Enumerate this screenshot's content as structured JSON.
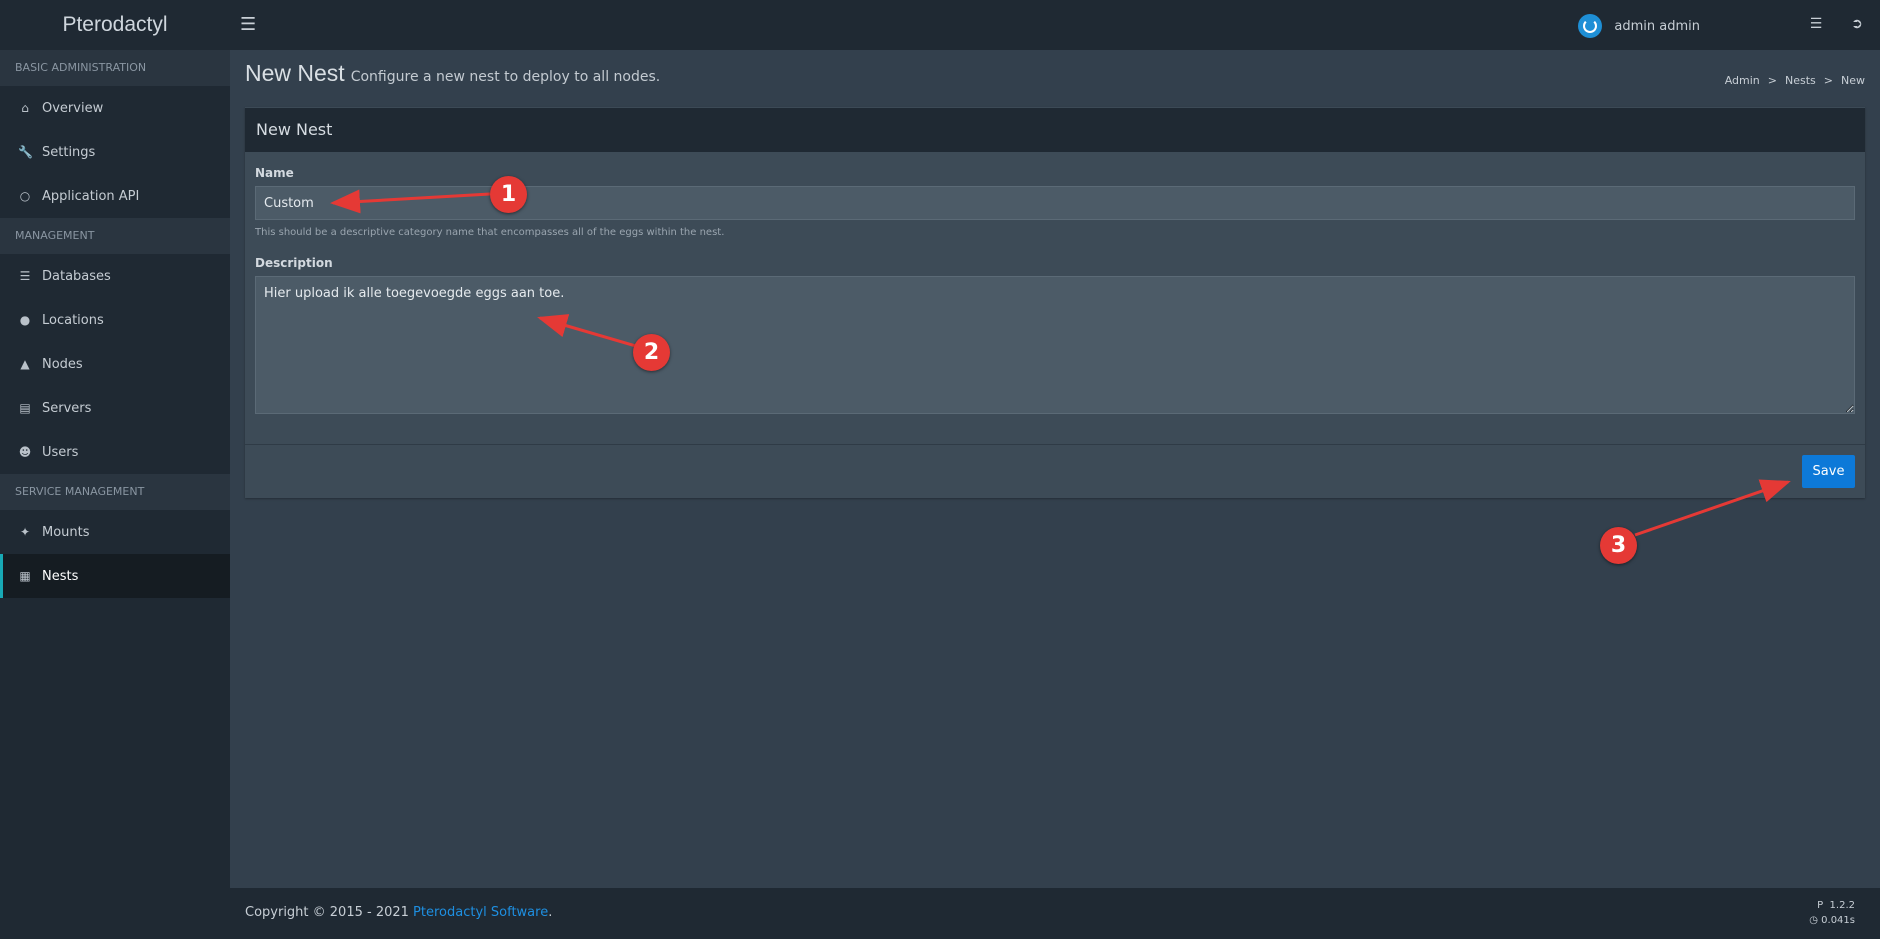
{
  "app": {
    "logo": "Pterodactyl",
    "user_name": "admin admin"
  },
  "sidebar": {
    "sections": [
      {
        "title": "BASIC ADMINISTRATION",
        "items": [
          {
            "label": "Overview",
            "icon": "home-icon"
          },
          {
            "label": "Settings",
            "icon": "wrench-icon"
          },
          {
            "label": "Application API",
            "icon": "gamepad-icon"
          }
        ]
      },
      {
        "title": "MANAGEMENT",
        "items": [
          {
            "label": "Databases",
            "icon": "database-icon"
          },
          {
            "label": "Locations",
            "icon": "globe-icon"
          },
          {
            "label": "Nodes",
            "icon": "sitemap-icon"
          },
          {
            "label": "Servers",
            "icon": "server-icon"
          },
          {
            "label": "Users",
            "icon": "users-icon"
          }
        ]
      },
      {
        "title": "SERVICE MANAGEMENT",
        "items": [
          {
            "label": "Mounts",
            "icon": "magic-icon"
          },
          {
            "label": "Nests",
            "icon": "th-large-icon",
            "active": true
          }
        ]
      }
    ]
  },
  "header": {
    "title": "New Nest",
    "subtitle": "Configure a new nest to deploy to all nodes.",
    "breadcrumb": [
      "Admin",
      "Nests",
      "New"
    ]
  },
  "form": {
    "box_title": "New Nest",
    "name_label": "Name",
    "name_value": "Custom",
    "name_help": "This should be a descriptive category name that encompasses all of the eggs within the nest.",
    "description_label": "Description",
    "description_value": "Hier upload ik alle toegevoegde eggs aan toe.",
    "save_label": "Save"
  },
  "footer": {
    "copyright_prefix": "Copyright © 2015 - 2021 ",
    "copyright_link": "Pterodactyl Software",
    "copyright_suffix": ".",
    "version": "1.2.2",
    "render_time": "0.041s"
  },
  "annotations": [
    "1",
    "2",
    "3"
  ],
  "colors": {
    "accent": "#18a9b5",
    "save_button": "#0d79d8",
    "annotation": "#e53935",
    "link": "#1e8fe1"
  }
}
